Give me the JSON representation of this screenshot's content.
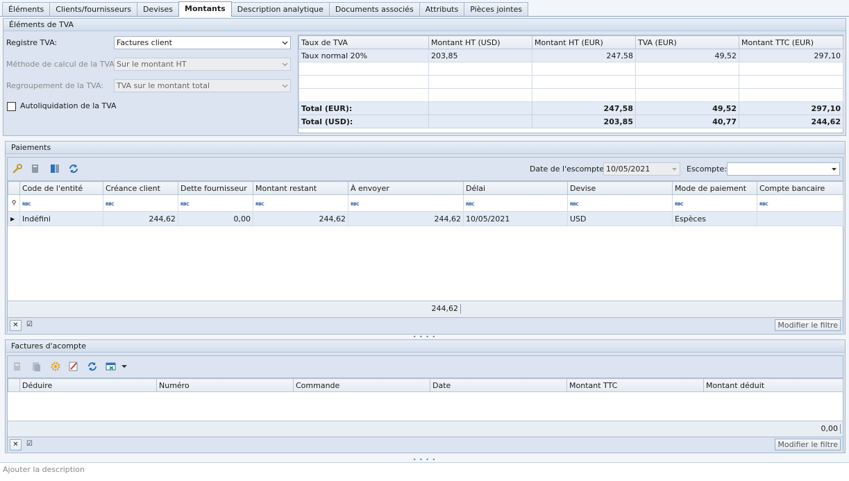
{
  "tabs": [
    {
      "label": "Éléments"
    },
    {
      "label": "Clients/fournisseurs"
    },
    {
      "label": "Devises"
    },
    {
      "label": "Montants"
    },
    {
      "label": "Description analytique"
    },
    {
      "label": "Documents associés"
    },
    {
      "label": "Attributs"
    },
    {
      "label": "Pièces jointes"
    }
  ],
  "tva_section": {
    "title": "Éléments de TVA",
    "registre_label": "Registre TVA:",
    "registre_value": "Factures client",
    "methode_label": "Méthode de calcul de la TVA:",
    "methode_value": "Sur le montant HT",
    "regroupement_label": "Regroupement de la TVA:",
    "regroupement_value": "TVA sur le montant total",
    "autoliquidation_label": "Autoliquidation de la TVA",
    "table": {
      "headers": [
        "Taux de TVA",
        "Montant HT (USD)",
        "Montant HT (EUR)",
        "TVA (EUR)",
        "Montant TTC (EUR)"
      ],
      "row": [
        "Taux normal 20%",
        "203,85",
        "247,58",
        "49,52",
        "297,10"
      ],
      "total_eur": [
        "Total (EUR):",
        "",
        "247,58",
        "49,52",
        "297,10"
      ],
      "total_usd": [
        "Total (USD):",
        "",
        "203,85",
        "40,77",
        "244,62"
      ]
    }
  },
  "paiements": {
    "title": "Paiements",
    "date_escompte_label": "Date de l'escompte:",
    "date_escompte_value": "10/05/2021",
    "escompte_label": "Escompte:",
    "escompte_value": "",
    "headers": [
      "Code de l'entité",
      "Créance client",
      "Dette fournisseur",
      "Montant restant",
      "À envoyer",
      "Délai",
      "Devise",
      "Mode de paiement",
      "Compte bancaire"
    ],
    "filter_placeholder": "RBC",
    "row": [
      "Indéfini",
      "244,62",
      "0,00",
      "244,62",
      "244,62",
      "10/05/2021",
      "USD",
      "Espèces",
      ""
    ],
    "summary_value": "244,62",
    "filter_button": "Modifier le filtre"
  },
  "factures": {
    "title": "Factures d'acompte",
    "headers": [
      "Déduire",
      "Numéro",
      "Commande",
      "Date",
      "Montant TTC",
      "Montant déduit"
    ],
    "summary_value": "0,00",
    "filter_button": "Modifier le filtre"
  },
  "description": {
    "placeholder": "Ajouter la description"
  },
  "colors": {
    "accent": "#3a73b8",
    "frame": "#a7b8cf",
    "panel": "#dbe4f0",
    "highlight_row": "#e3ebf6"
  }
}
